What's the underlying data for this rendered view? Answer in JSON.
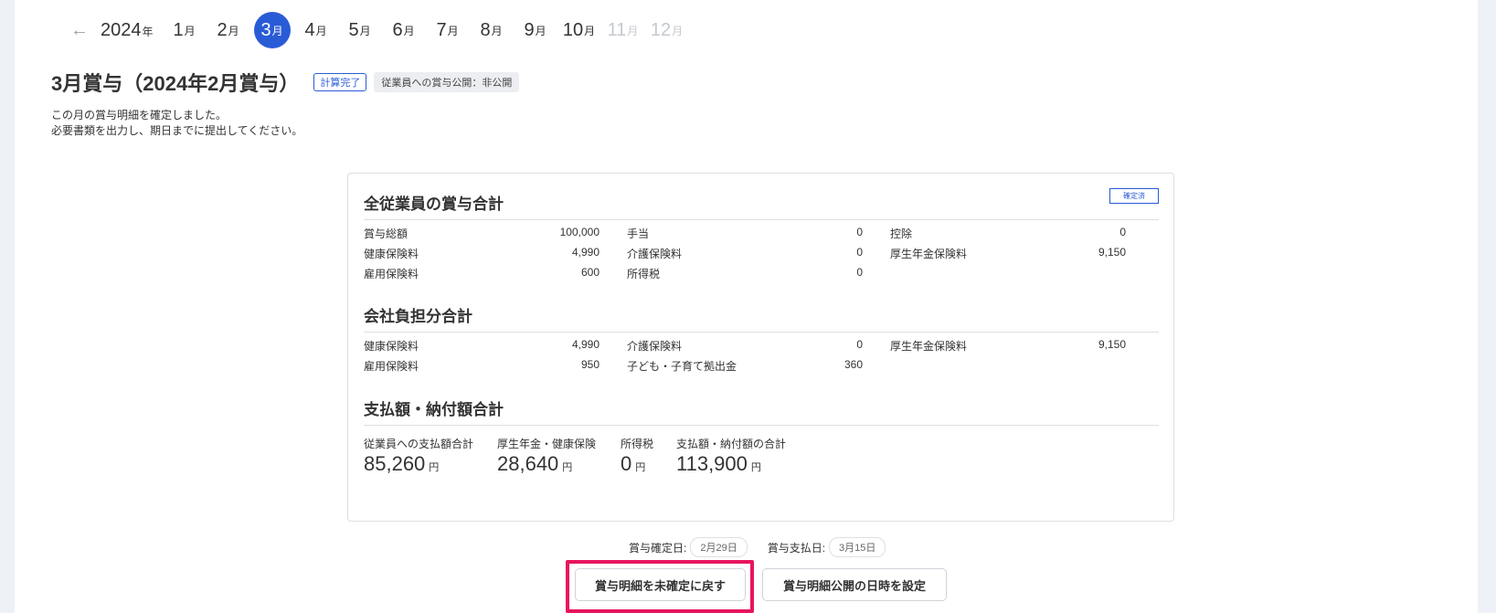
{
  "nav": {
    "year": "2024",
    "year_suffix": "年",
    "month_suffix": "月",
    "months": [
      {
        "label": "1",
        "state": "normal"
      },
      {
        "label": "2",
        "state": "normal"
      },
      {
        "label": "3",
        "state": "active"
      },
      {
        "label": "4",
        "state": "normal"
      },
      {
        "label": "5",
        "state": "normal"
      },
      {
        "label": "6",
        "state": "normal"
      },
      {
        "label": "7",
        "state": "normal"
      },
      {
        "label": "8",
        "state": "normal"
      },
      {
        "label": "9",
        "state": "normal"
      },
      {
        "label": "10",
        "state": "normal"
      },
      {
        "label": "11",
        "state": "disabled"
      },
      {
        "label": "12",
        "state": "disabled"
      }
    ]
  },
  "header": {
    "title": "3月賞与（2024年2月賞与）",
    "status_badge": "計算完了",
    "publish_badge": "従業員への賞与公開：非公開",
    "desc_line1": "この月の賞与明細を確定しました。",
    "desc_line2": "必要書類を出力し、期日までに提出してください。"
  },
  "card": {
    "badge": "確定済",
    "section1": {
      "title": "全従業員の賞与合計",
      "items": [
        {
          "label": "賞与総額",
          "value": "100,000"
        },
        {
          "label": "手当",
          "value": "0"
        },
        {
          "label": "控除",
          "value": "0"
        },
        {
          "label": "健康保険料",
          "value": "4,990"
        },
        {
          "label": "介護保険料",
          "value": "0"
        },
        {
          "label": "厚生年金保険料",
          "value": "9,150"
        },
        {
          "label": "雇用保険料",
          "value": "600"
        },
        {
          "label": "所得税",
          "value": "0"
        }
      ]
    },
    "section2": {
      "title": "会社負担分合計",
      "items": [
        {
          "label": "健康保険料",
          "value": "4,990"
        },
        {
          "label": "介護保険料",
          "value": "0"
        },
        {
          "label": "厚生年金保険料",
          "value": "9,150"
        },
        {
          "label": "雇用保険料",
          "value": "950"
        },
        {
          "label": "子ども・子育て拠出金",
          "value": "360"
        }
      ]
    },
    "section3": {
      "title": "支払額・納付額合計",
      "currency": "円",
      "items": [
        {
          "label": "従業員への支払額合計",
          "value": "85,260"
        },
        {
          "label": "厚生年金・健康保険",
          "value": "28,640"
        },
        {
          "label": "所得税",
          "value": "0"
        },
        {
          "label": "支払額・納付額の合計",
          "value": "113,900"
        }
      ]
    }
  },
  "dates": {
    "confirm_label": "賞与確定日:",
    "confirm_value": "2月29日",
    "pay_label": "賞与支払日:",
    "pay_value": "3月15日"
  },
  "buttons": {
    "unconfirm": "賞与明細を未確定に戻す",
    "schedule": "賞与明細公開の日時を設定"
  },
  "colors": {
    "accent": "#2a5bd7",
    "highlight": "#e8155f",
    "background": "#eef1f8"
  }
}
